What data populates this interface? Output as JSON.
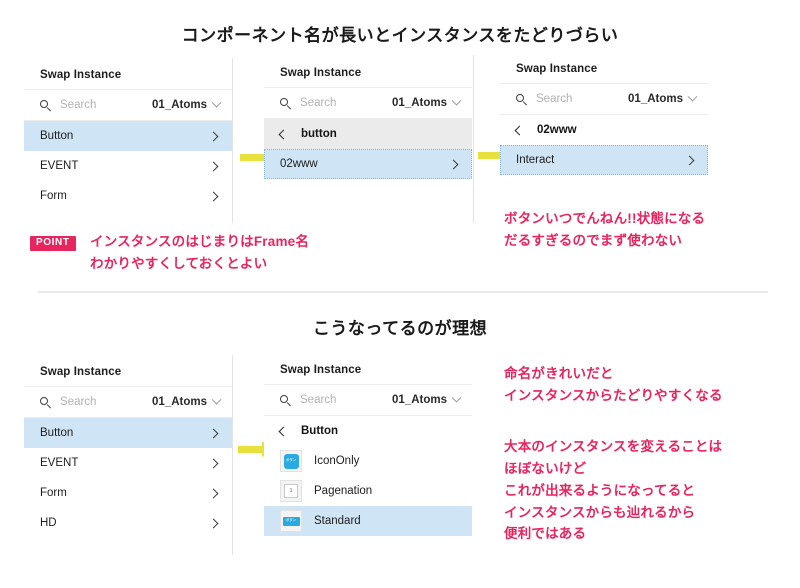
{
  "sections": {
    "top_title": "コンポーネント名が長いとインスタンスをたどりづらい",
    "bottom_title": "こうなってるのが理想"
  },
  "common": {
    "panel_title": "Swap Instance",
    "search_placeholder": "Search",
    "library": "01_Atoms",
    "grid_icon": "grid-icon",
    "search_icon": "search-icon",
    "chevron_down_icon": "chevron-down-icon",
    "chevron_right_icon": "chevron-right-icon",
    "chevron_left_icon": "chevron-left-icon"
  },
  "top_row": {
    "panel1": {
      "title": "Swap Instance",
      "search_placeholder": "Search",
      "library": "01_Atoms",
      "items": [
        {
          "label": "Button",
          "selected": true
        },
        {
          "label": "EVENT",
          "selected": false
        },
        {
          "label": "Form",
          "selected": false
        }
      ]
    },
    "panel2": {
      "title": "Swap Instance",
      "search_placeholder": "Search",
      "library": "01_Atoms",
      "breadcrumb": "button",
      "items": [
        {
          "label": "02www",
          "selected": true
        }
      ]
    },
    "panel3": {
      "title": "Swap Instance",
      "search_placeholder": "Search",
      "library": "01_Atoms",
      "breadcrumb": "02www",
      "items": [
        {
          "label": "Interact",
          "selected": true
        }
      ]
    }
  },
  "bottom_row": {
    "panel1": {
      "title": "Swap Instance",
      "search_placeholder": "Search",
      "library": "01_Atoms",
      "items": [
        {
          "label": "Button",
          "selected": true
        },
        {
          "label": "EVENT",
          "selected": false
        },
        {
          "label": "Form",
          "selected": false
        },
        {
          "label": "HD",
          "selected": false
        }
      ]
    },
    "panel2": {
      "title": "Swap Instance",
      "search_placeholder": "Search",
      "library": "01_Atoms",
      "breadcrumb": "Button",
      "components": [
        {
          "label": "IconOnly",
          "thumb": "blue-rounded-square",
          "thumb_text": "ボタン",
          "selected": false
        },
        {
          "label": "Pagenation",
          "thumb": "white-square-number",
          "thumb_text": "1",
          "selected": false
        },
        {
          "label": "Standard",
          "thumb": "blue-pill",
          "thumb_text": "ボタン",
          "selected": true
        }
      ]
    }
  },
  "annotations": {
    "point_badge": "POINT",
    "point_text": "インスタンスのはじまりはFrame名\nわかりやすくしておくとよい",
    "top_right_text": "ボタンいつでんねん!!状態になる\nだるすぎるのでまず使わない",
    "bottom_right_text_1": "命名がきれいだと\nインスタンスからたどりやすくなる",
    "bottom_right_text_2": "大本のインスタンスを変えることは\nほぼないけど\nこれが出来るようになってると\nインスタンスからも辿れるから\n便利ではある"
  },
  "colors": {
    "accent_pink": "#e8245f",
    "arrow_yellow": "#e8e03c",
    "selection_blue": "#cfe4f5",
    "thumb_blue": "#29abe2"
  }
}
